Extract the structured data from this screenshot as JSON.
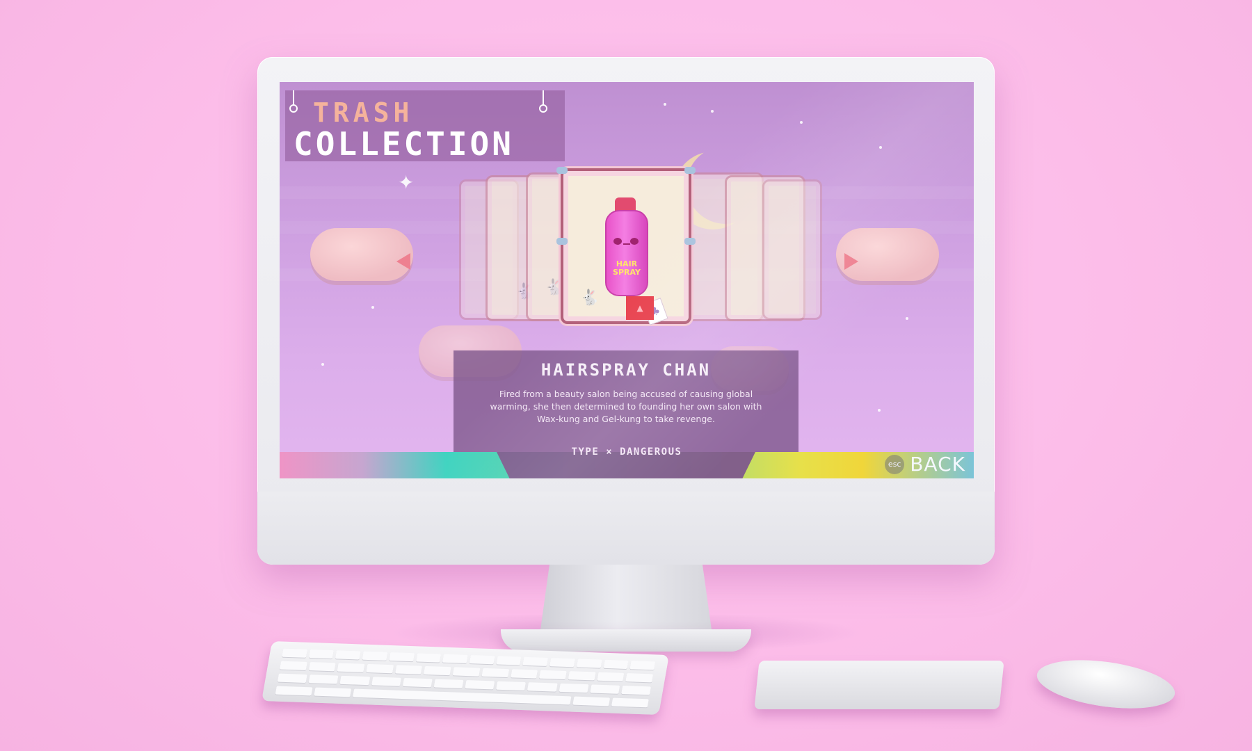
{
  "game": {
    "title_top": "TRASH",
    "title_bottom": "COLLECTION",
    "character": {
      "name": "HAIRSPRAY CHAN",
      "description": "Fired from a beauty salon being accused of causing global warming, she then determined to founding her own salon with Wax-kung and Gel-kung to take revenge.",
      "type_label": "TYPE",
      "type_separator": "×",
      "type_value": "DANGEROUS",
      "can_label": "HAIR SPRAY"
    },
    "nav": {
      "prev_icon": "triangle-left-icon",
      "next_icon": "triangle-right-icon"
    },
    "back": {
      "key": "esc",
      "label": "BACK"
    },
    "colors": {
      "background_pink": "#fcbde9",
      "screen_purple": "#cd9fe0",
      "title_accent": "#f5b39c",
      "arrow": "#ee8090",
      "panel": "#7e588c"
    }
  }
}
